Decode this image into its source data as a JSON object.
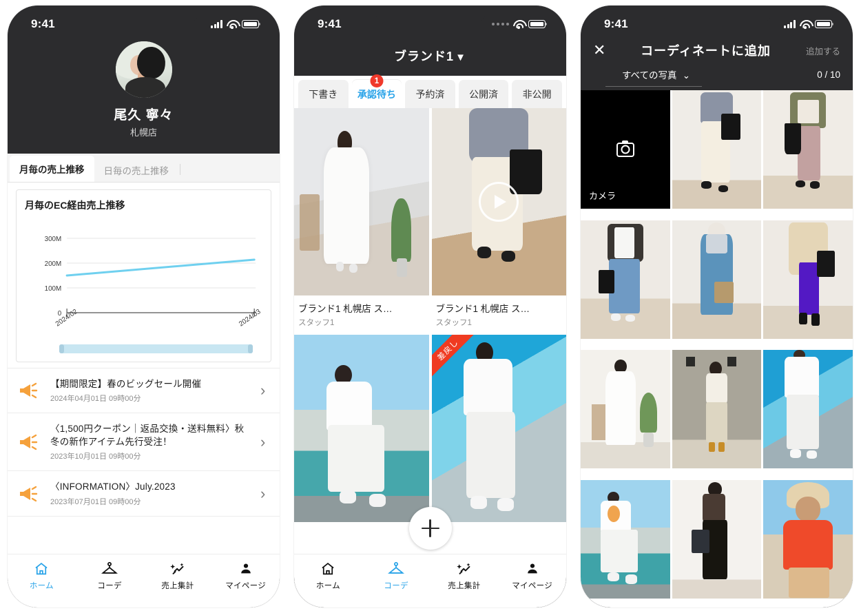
{
  "phone1": {
    "status": {
      "time": "9:41",
      "signal": "signal-bars-icon",
      "wifi": "wifi-icon",
      "battery": "battery-icon"
    },
    "profile": {
      "name": "尾久 寧々",
      "store": "札幌店",
      "avatar_alt": "avatar"
    },
    "tabs": [
      {
        "label": "月毎の売上推移",
        "active": true
      },
      {
        "label": "日毎の売上推移",
        "active": false
      }
    ],
    "chart_card": {
      "title": "月毎のEC経由売上推移"
    },
    "notifications": [
      {
        "title": "【期間限定】春のビッグセール開催",
        "date": "2024年04月01日 09時00分",
        "icon": "megaphone-icon"
      },
      {
        "title": "〈1,500円クーポン｜返品交換・送料無料〉秋冬の新作アイテム先行受注！",
        "date": "2023年10月01日 09時00分",
        "icon": "megaphone-icon"
      },
      {
        "title": "〈INFORMATION〉July.2023",
        "date": "2023年07月01日 09時00分",
        "icon": "megaphone-icon"
      }
    ],
    "tabbar": [
      {
        "label": "ホーム",
        "icon": "home-icon",
        "active": true
      },
      {
        "label": "コーデ",
        "icon": "hanger-icon",
        "active": false
      },
      {
        "label": "売上集計",
        "icon": "sparkle-chart-icon",
        "active": false
      },
      {
        "label": "マイページ",
        "icon": "person-icon",
        "active": false
      }
    ]
  },
  "phone2": {
    "status": {
      "time": "9:41",
      "signal": "signal-dots-icon",
      "wifi": "wifi-icon",
      "battery": "battery-icon"
    },
    "header": {
      "title": "ブランド1",
      "caret": "▼"
    },
    "tabs": [
      {
        "label": "下書き",
        "active": false,
        "badge": null
      },
      {
        "label": "承認待ち",
        "active": true,
        "badge": "1"
      },
      {
        "label": "予約済",
        "active": false,
        "badge": null
      },
      {
        "label": "公開済",
        "active": false,
        "badge": null
      },
      {
        "label": "非公開",
        "active": false,
        "badge": null
      }
    ],
    "posts": [
      {
        "title": "ブランド1 札幌店 ス…",
        "staff": "スタッフ1",
        "media": "image",
        "ribbon": null
      },
      {
        "title": "ブランド1 札幌店 ス…",
        "staff": "スタッフ1",
        "media": "video",
        "ribbon": null
      },
      {
        "title": "",
        "staff": "",
        "media": "image",
        "ribbon": null
      },
      {
        "title": "",
        "staff": "",
        "media": "image",
        "ribbon": "差戻し"
      }
    ],
    "fab": {
      "label": "+",
      "icon": "plus-icon"
    },
    "tabbar": [
      {
        "label": "ホーム",
        "icon": "home-icon",
        "active": false
      },
      {
        "label": "コーデ",
        "icon": "hanger-icon",
        "active": true
      },
      {
        "label": "売上集計",
        "icon": "sparkle-chart-icon",
        "active": false
      },
      {
        "label": "マイページ",
        "icon": "person-icon",
        "active": false
      }
    ]
  },
  "phone3": {
    "status": {
      "time": "9:41",
      "signal": "signal-bars-icon",
      "wifi": "wifi-icon",
      "battery": "battery-icon"
    },
    "nav": {
      "close": "✕",
      "title": "コーディネートに追加",
      "action": "追加する"
    },
    "subbar": {
      "album": "すべての写真",
      "caret": "❯",
      "count": "0 / 10"
    },
    "camera_tile": {
      "label": "カメラ",
      "icon": "camera-icon"
    },
    "photos": [
      {
        "alt": "grey-knit-cream-pants"
      },
      {
        "alt": "khaki-jacket-pink-pants"
      },
      {
        "alt": "leather-jacket-denim"
      },
      {
        "alt": "blue-camisole-dress"
      },
      {
        "alt": "beige-coat-purple-skirt"
      },
      {
        "alt": "white-dress-plant"
      },
      {
        "alt": "white-top-culottes"
      },
      {
        "alt": "white-tee-graffiti"
      },
      {
        "alt": "white-tee-rooftop"
      },
      {
        "alt": "brown-top-black-skirt"
      },
      {
        "alt": "red-blouse-hat"
      }
    ]
  },
  "colors": {
    "accent": "#29a3e8",
    "badge_red": "#f0392b",
    "ribbon_red": "#ef3b21",
    "chart_line": "#6fd0ef",
    "slider_fill": "#c8e6f2",
    "phone_body": "#2c2c2e",
    "megaphone_orange": "#f5a13c"
  },
  "chart_data": {
    "type": "line",
    "title": "月毎のEC経由売上推移",
    "x": [
      "2024/02",
      "2024/03"
    ],
    "values": [
      150,
      215
    ],
    "yticks": [
      "0",
      "100M",
      "200M",
      "300M"
    ],
    "ytick_values": [
      0,
      100,
      200,
      300
    ],
    "ylim": [
      0,
      300
    ],
    "xlabel": "",
    "ylabel": "",
    "unit": "M",
    "grid": true,
    "legend": "none",
    "series": [
      {
        "name": "EC経由売上",
        "values": [
          150,
          215
        ],
        "color": "#6fd0ef"
      }
    ]
  }
}
